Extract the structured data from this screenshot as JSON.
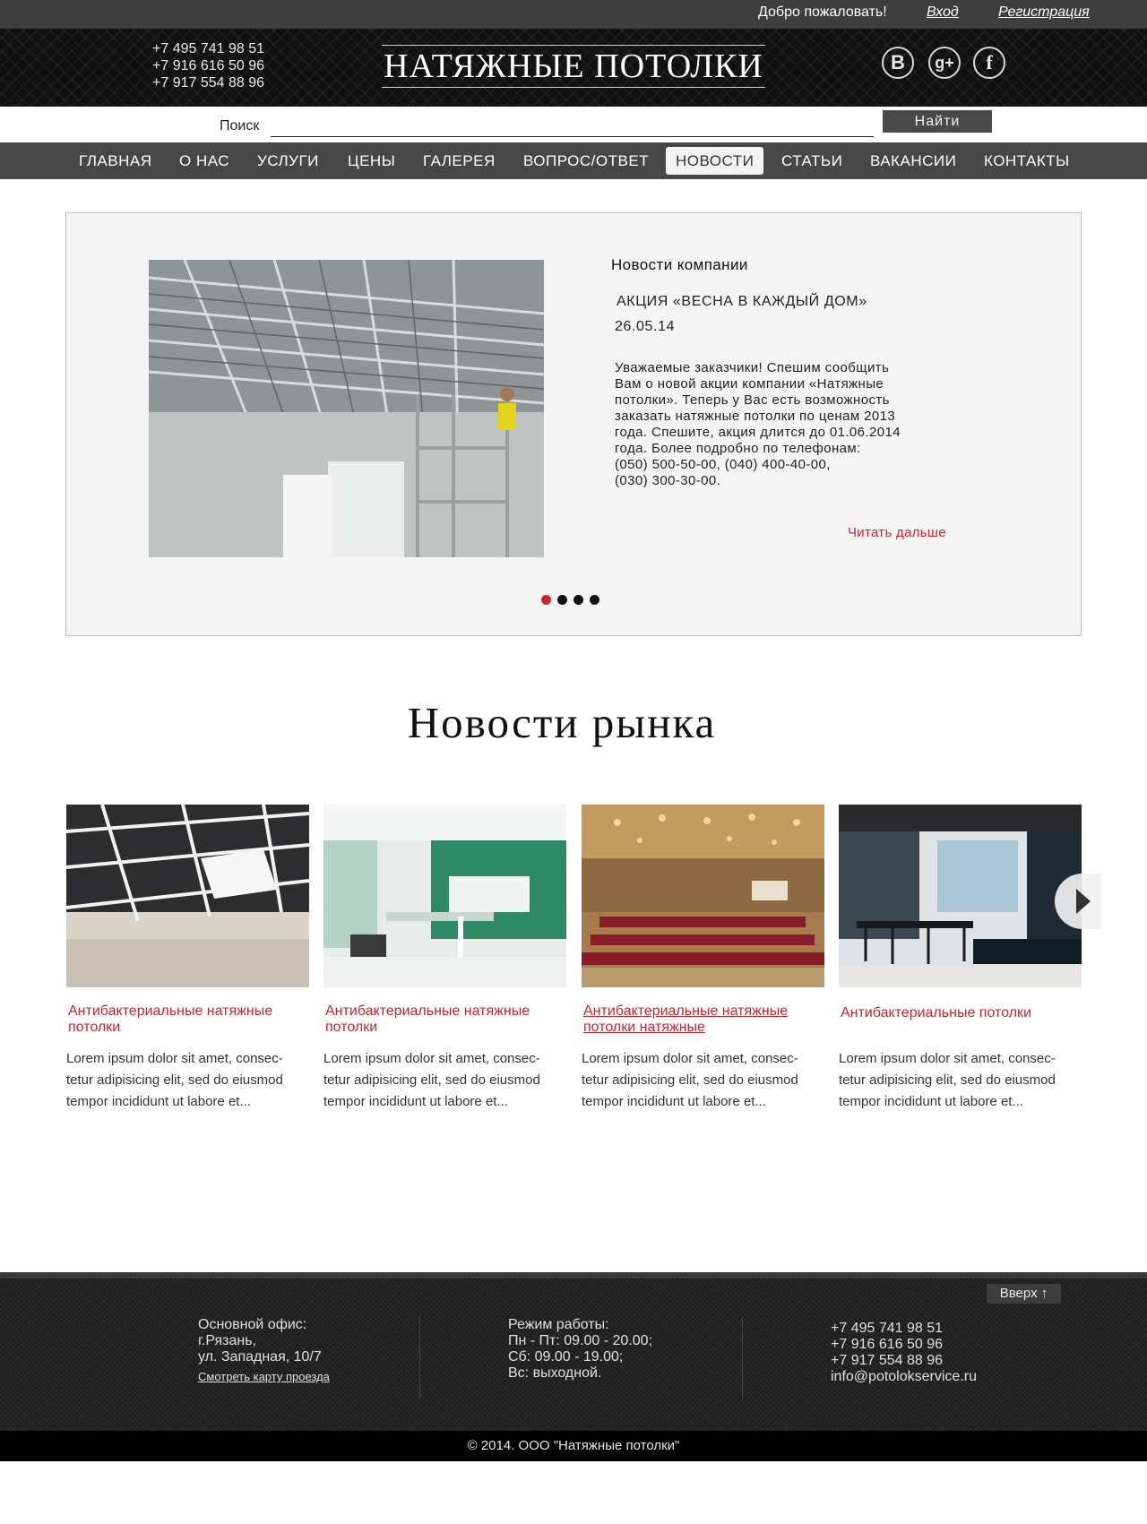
{
  "topbar": {
    "welcome": "Добро пожаловать!",
    "login": "Вход",
    "register": "Регистрация"
  },
  "header": {
    "phones": [
      "+7 495 741 98 51",
      "+7 916 616 50 96",
      "+7 917 554 88 96"
    ],
    "logo": "НАТЯЖНЫЕ ПОТОЛКИ",
    "social": [
      {
        "icon": "vk-icon",
        "glyph": "B"
      },
      {
        "icon": "google-plus-icon",
        "glyph": "g+"
      },
      {
        "icon": "facebook-icon",
        "glyph": "f"
      }
    ]
  },
  "search": {
    "label": "Поиск",
    "value": "",
    "button": "Найти"
  },
  "nav": {
    "items": [
      "ГЛАВНАЯ",
      "О НАС",
      "УСЛУГИ",
      "ЦЕНЫ",
      "ГАЛЕРЕЯ",
      "ВОПРОС/ОТВЕТ",
      "НОВОСТИ",
      "СТАТЬИ",
      "ВАКАНСИИ",
      "КОНТАКТЫ"
    ],
    "active": "НОВОСТИ"
  },
  "featured": {
    "section_title": "Новости компании",
    "headline": "АКЦИЯ «ВЕСНА В КАЖДЫЙ ДОМ»",
    "date": "26.05.14",
    "body_lines": [
      "Уважаемые заказчики! Спешим сообщить",
      "Вам о новой акции компании «Натяжные",
      "потолки». Теперь у Вас есть возможность",
      "заказать натяжные потолки по ценам 2013",
      "года. Спешите, акция длится до 01.06.2014",
      "года. Более подробно по телефонам:",
      "(050) 500-50-00, (040) 400-40-00,",
      "(030) 300-30-00."
    ],
    "read_more": "Читать дальше",
    "slides_total": 4,
    "slide_active": 1
  },
  "market": {
    "title": "Новости рынка",
    "cards": [
      {
        "title": "Антибактериальные натяжные потолки",
        "desc": [
          "Lorem ipsum dolor sit amet, consec-",
          "tetur adipisicing elit, sed do eiusmod",
          "tempor incididunt ut labore et..."
        ]
      },
      {
        "title": "Антибактериальные натяжные потолки",
        "desc": [
          "Lorem ipsum dolor sit amet, consec-",
          "tetur adipisicing elit, sed do eiusmod",
          "tempor incididunt ut labore et..."
        ]
      },
      {
        "title": "Антибактериальные натяжные потолки натяжные",
        "desc": [
          "Lorem ipsum dolor sit amet, consec-",
          "tetur adipisicing elit, sed do eiusmod",
          "tempor incididunt ut labore et..."
        ]
      },
      {
        "title": "Антибактериальные  потолки",
        "desc": [
          "Lorem ipsum dolor sit amet, consec-",
          "tetur adipisicing elit, sed do eiusmod",
          "tempor incididunt ut labore et..."
        ]
      }
    ]
  },
  "footer": {
    "to_top": "Вверх ↑",
    "office": [
      "Основной офис:",
      "г.Рязань,",
      "ул. Западная, 10/7"
    ],
    "map_link": "Смотреть карту проезда",
    "hours": [
      "Режим работы:",
      "Пн - Пт: 09.00 - 20.00;",
      "Сб: 09.00 - 19.00;",
      "Вс: выходной."
    ],
    "contacts": [
      "+7 495 741 98 51",
      "+7 916 616 50 96",
      "+7 917 554 88 96",
      "info@potolokservice.ru"
    ],
    "copyright": "© 2014. ООО \"Натяжные потолки\""
  },
  "colors": {
    "accent": "#c7262e",
    "nav_bg": "#474747",
    "topbar_bg": "#3e3e3e",
    "footer_bg": "#1f1f1f"
  }
}
